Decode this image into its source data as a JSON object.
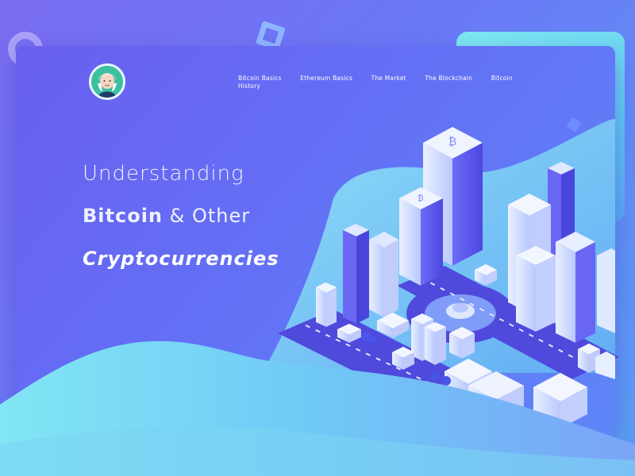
{
  "nav": {
    "items": [
      {
        "label": "Bitcoin Basics"
      },
      {
        "label": "Ethereum Basics"
      },
      {
        "label": "The Market"
      },
      {
        "label": "The Blockchain"
      },
      {
        "label": "Bitcoin"
      }
    ],
    "overflow_label": "History"
  },
  "hero": {
    "line1": "Understanding",
    "line2_bold": "Bitcoin",
    "line2_rest": " & Other",
    "line3": "Cryptocurrencies"
  },
  "colors": {
    "background": "#6a78f6",
    "card": "#6370f5",
    "accent_teal": "#7fe9f0",
    "building_blue": "#5b58f2",
    "road": "#4a44d8"
  },
  "icons": {
    "logo": "avatar-portrait-icon",
    "buildings": "bitcoin-icon"
  }
}
